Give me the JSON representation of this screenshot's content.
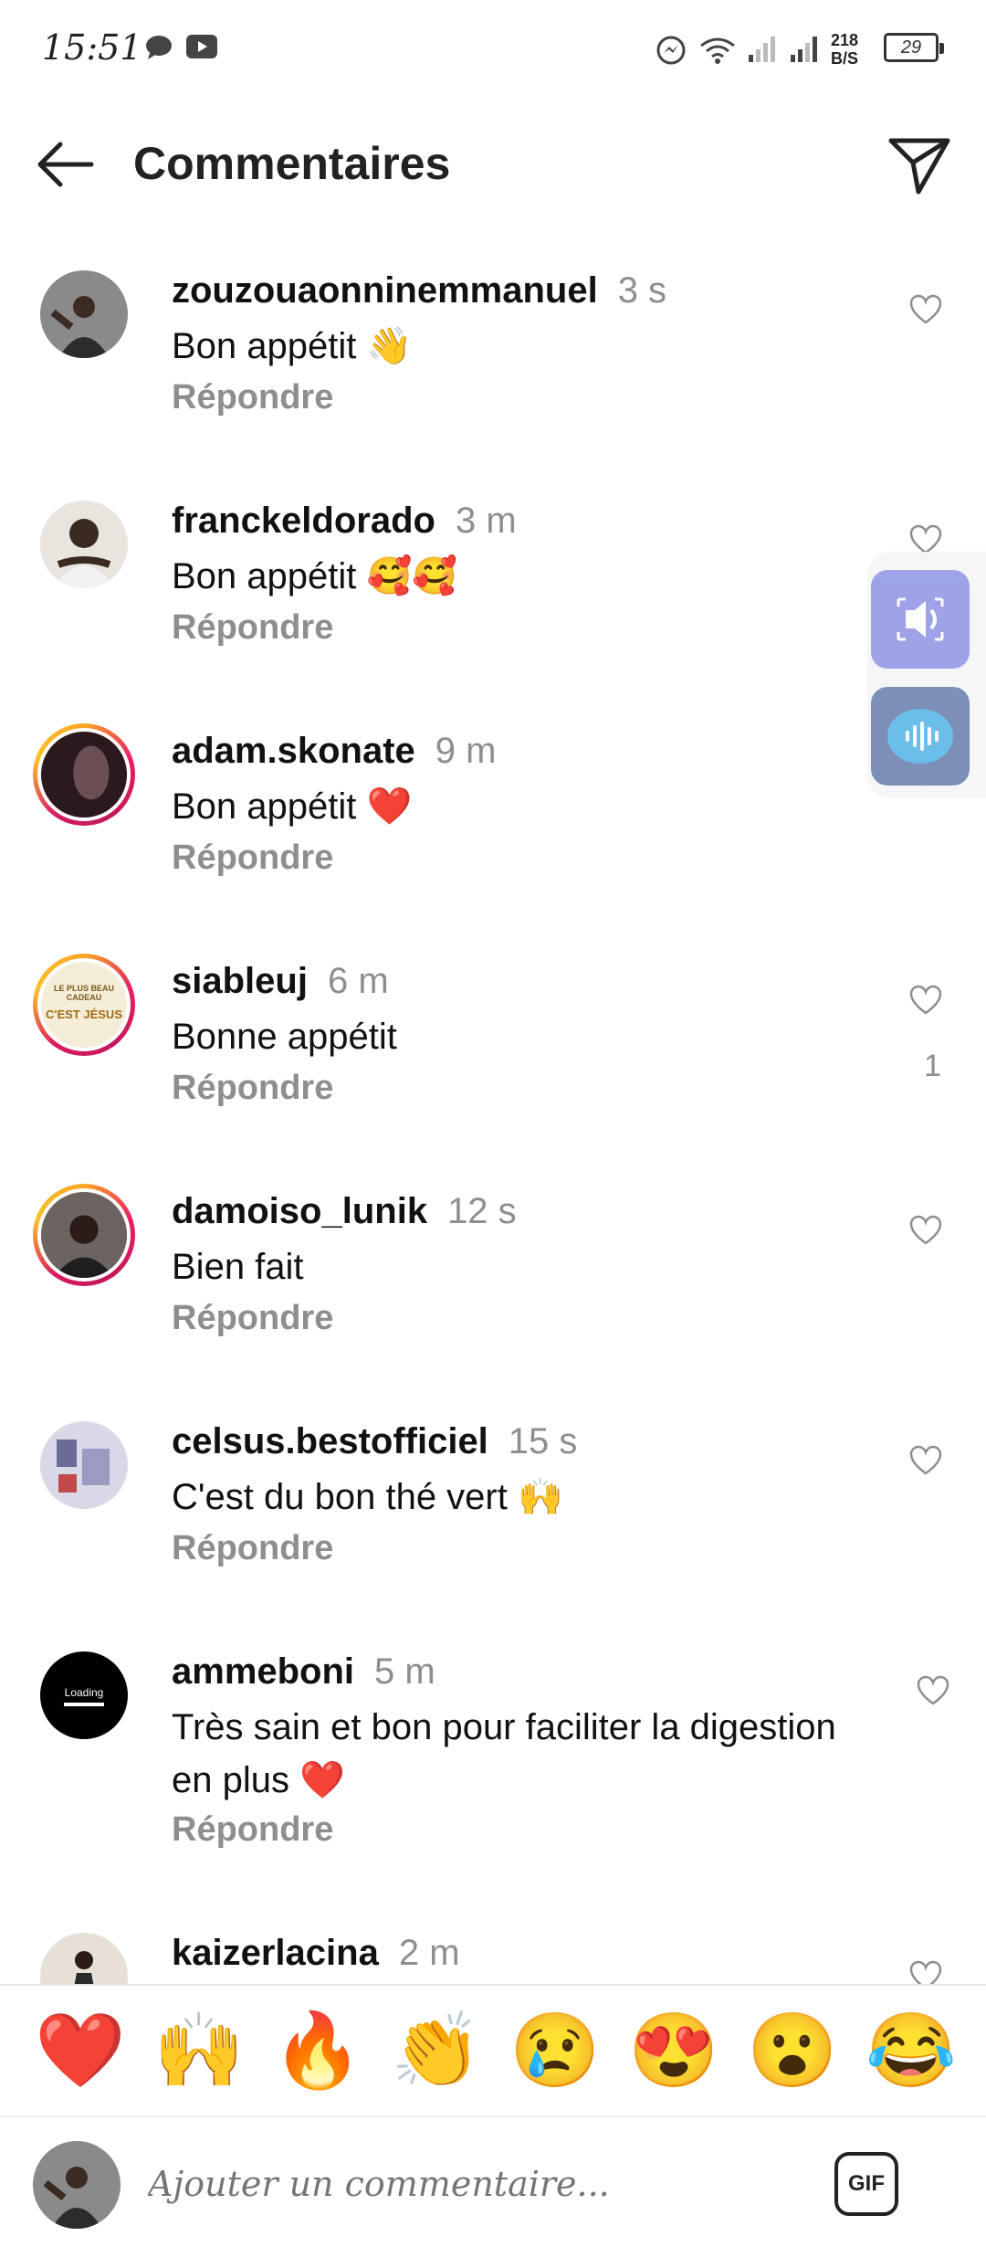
{
  "status_bar": {
    "time": "15:51",
    "network_speed": "218",
    "speed_unit": "B/S",
    "battery": "29"
  },
  "header": {
    "title": "Commentaires"
  },
  "comments": [
    {
      "user": "zouzouaonninemmanuel",
      "time": "3 s",
      "text": "Bon appétit 👋",
      "reply": "Répondre"
    },
    {
      "user": "franckeldorado",
      "time": "3 m",
      "text": "Bon appétit 🥰🥰",
      "reply": "Répondre"
    },
    {
      "user": "adam.skonate",
      "time": "9 m",
      "text": "Bon appétit ❤️",
      "reply": "Répondre"
    },
    {
      "user": "siableuj",
      "time": "6 m",
      "text": "Bonne appétit",
      "reply": "Répondre",
      "likes": "1"
    },
    {
      "user": "damoiso_lunik",
      "time": "12 s",
      "text": "Bien fait",
      "reply": "Répondre"
    },
    {
      "user": "celsus.bestofficiel",
      "time": "15 s",
      "text": "C'est du bon thé vert 🙌",
      "reply": "Répondre"
    },
    {
      "user": "ammeboni",
      "time": "5 m",
      "text": "Très sain et bon pour faciliter la digestion en plus ❤️",
      "reply": "Répondre",
      "avatar_text": "Loading"
    },
    {
      "user": "kaizerlacina",
      "time": "2 m"
    }
  ],
  "avatar_texts": {
    "siableuj_line1": "LE PLUS BEAU CADEAU",
    "siableuj_line2": "C'EST JÉSUS"
  },
  "quick_emojis": [
    "❤️",
    "🙌",
    "🔥",
    "👏",
    "😢",
    "😍",
    "😮",
    "😂"
  ],
  "composer": {
    "placeholder": "Ajouter un commentaire...",
    "gif_label": "GIF"
  },
  "colors": {
    "muted": "#8e8e8e",
    "text": "#111111",
    "story_ring": "#e91e63"
  }
}
